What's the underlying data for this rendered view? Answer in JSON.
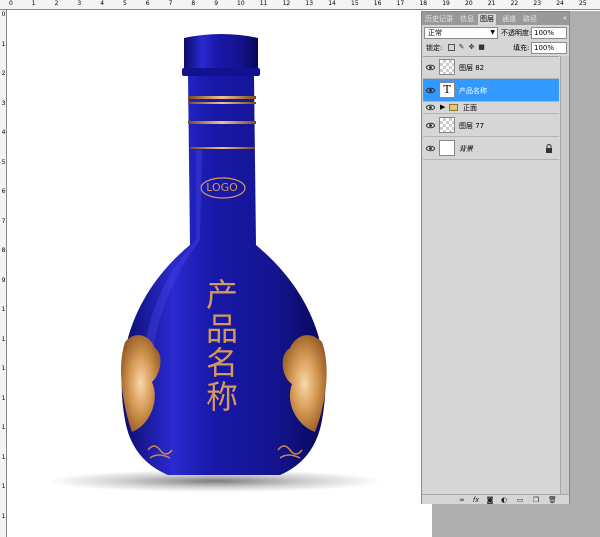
{
  "ruler": {
    "top_numbers": [
      "0",
      "1",
      "2",
      "3",
      "4",
      "5",
      "6",
      "7",
      "8",
      "9",
      "10",
      "11",
      "12",
      "13",
      "14",
      "15",
      "16",
      "17",
      "18",
      "19",
      "20",
      "21",
      "22",
      "23",
      "24",
      "25"
    ],
    "left_numbers": [
      "0",
      "1",
      "2",
      "3",
      "4",
      "5",
      "6",
      "7",
      "8",
      "9",
      "10",
      "11",
      "12",
      "13",
      "14",
      "15",
      "16",
      "17"
    ]
  },
  "canvas": {
    "logo_text": "LOGO",
    "product_chars": [
      "产",
      "品",
      "名",
      "称"
    ],
    "bottle_color": "#1a1aa8",
    "gold_color": "#d49a5c"
  },
  "panel": {
    "tabs": [
      {
        "label": "历史记录",
        "active": false
      },
      {
        "label": "信息",
        "active": false
      },
      {
        "label": "图层",
        "active": true
      },
      {
        "label": "通道",
        "active": false
      },
      {
        "label": "路径",
        "active": false
      }
    ],
    "collapse_glyph": "«",
    "blend_mode": "正常",
    "opacity_label": "不透明度:",
    "opacity_value": "100%",
    "lock_label": "锁定:",
    "fill_label": "填充:",
    "fill_value": "100%",
    "layers": [
      {
        "name": "图层 82",
        "type": "raster",
        "selected": false
      },
      {
        "name": "产品名称",
        "type": "text",
        "selected": true,
        "thumb_glyph": "T"
      },
      {
        "name": "正面",
        "type": "group",
        "selected": false
      },
      {
        "name": "图层 77",
        "type": "raster",
        "selected": false
      },
      {
        "name": "背景",
        "type": "background",
        "selected": false
      }
    ],
    "footer_icons": [
      "link-icon",
      "fx-icon",
      "mask-icon",
      "adjustment-icon",
      "folder-icon",
      "new-layer-icon",
      "trash-icon"
    ]
  }
}
